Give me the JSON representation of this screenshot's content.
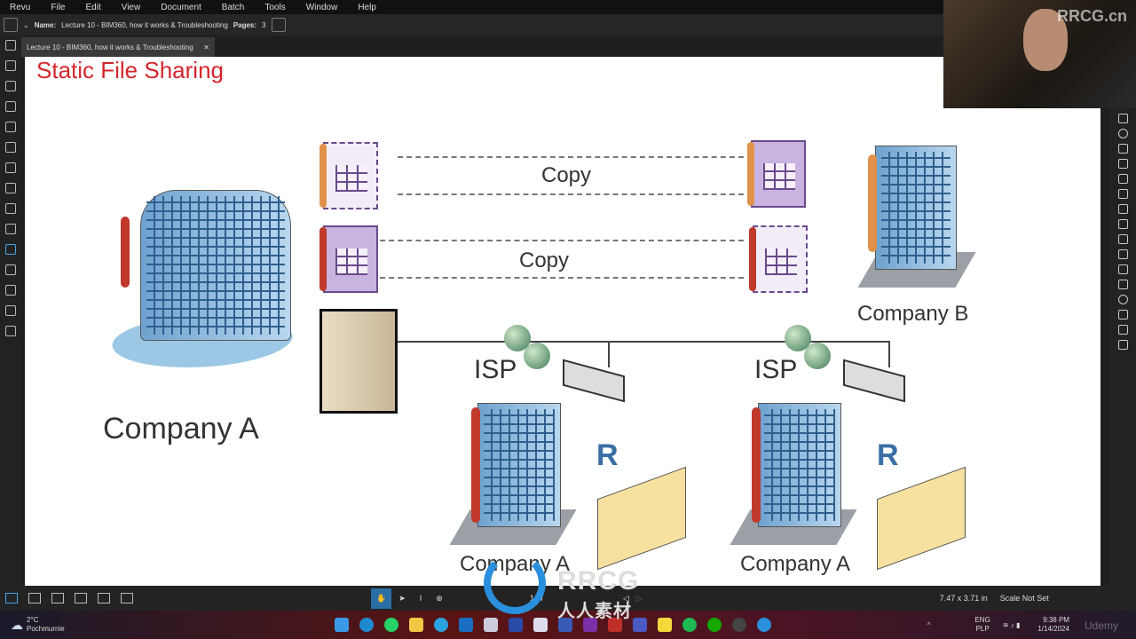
{
  "menu": [
    "Revu",
    "File",
    "Edit",
    "View",
    "Document",
    "Batch",
    "Tools",
    "Window",
    "Help"
  ],
  "info": {
    "name_label": "Name:",
    "name": "Lecture 10 - BIM360, how it works & Troubleshooting",
    "pages_label": "Pages:",
    "pages": "3"
  },
  "tab": {
    "title": "Lecture 10 - BIM360, how it works & Troubleshooting",
    "close": "✕"
  },
  "slide": {
    "title": "Static File Sharing",
    "copy1": "Copy",
    "copy2": "Copy",
    "company_a": "Company A",
    "company_b": "Company B",
    "isp1": "ISP",
    "isp2": "ISP",
    "r1": "R",
    "r2": "R",
    "company_a2": "Company A",
    "company_a3": "Company A"
  },
  "status": {
    "page": "1 of",
    "dimensions": "7.47 x 3.71 in",
    "scale": "Scale Not Set"
  },
  "taskbar": {
    "temp": "2°C",
    "weather": "Pochmurnie",
    "lang": "ENG",
    "layout": "PLP",
    "time": "9:38 PM",
    "date": "1/14/2024"
  },
  "watermark": {
    "corner": "RRCG.cn",
    "logo": "RRCG",
    "logo_sub": "人人素材",
    "udemy": "Udemy"
  },
  "colors": {
    "title": "#d4262c",
    "accent": "#2a8fdc"
  }
}
